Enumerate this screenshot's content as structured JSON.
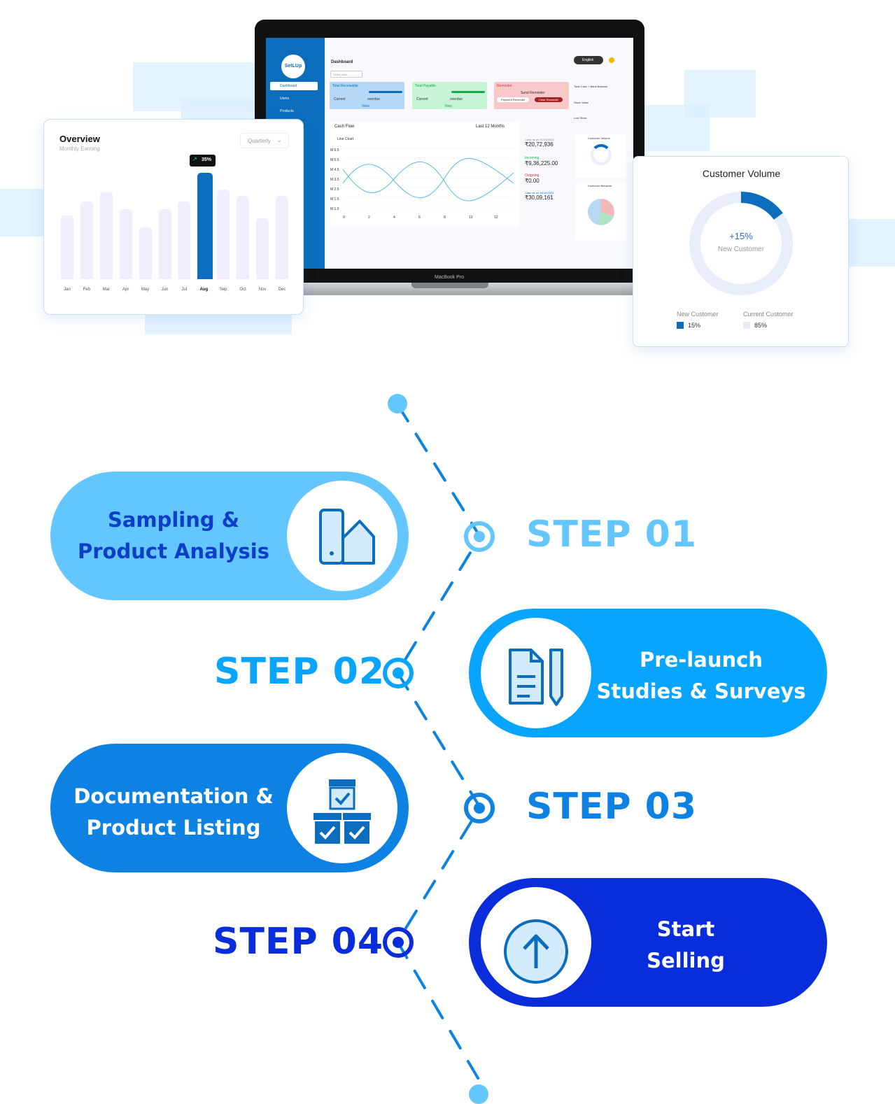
{
  "colors": {
    "step1": "#63c6ff",
    "step2": "#07a5ff",
    "step3": "#0e82e2",
    "step4": "#0a2ddb",
    "step1_text": "#0d3ec7",
    "brand": "#0c6dbd"
  },
  "laptop": {
    "brand": "SetLUp",
    "model_label": "MacBook Pro",
    "sidebar": [
      "Dashboard",
      "Users",
      "Products"
    ],
    "header_title": "Dashboard",
    "language": "English",
    "date_placeholder": "Select date",
    "cards": {
      "receivable": "Total Receivable",
      "payable": "Total Payable",
      "reminder": "Reminder",
      "reminder_action": "Send Reminder",
      "payment_reminder": "Payment Reminder",
      "clear_reminder": "Clear Reminder",
      "current": "Current",
      "overdue": "overdue",
      "view": "View",
      "total_cash": "Total Cash + Bank Balance",
      "stock_value": "Stock Value",
      "low_stock": "Low Stock"
    },
    "cash_flow": {
      "title": "Cash Flow",
      "period": "Last 12 Months",
      "chart_type": "Line Chart",
      "yticks": [
        "M 6.5",
        "M 5.5",
        "M 4.5",
        "M 3.5",
        "M 2.5",
        "M 1.5",
        "M 1.0"
      ],
      "xticks": [
        "0",
        "2",
        "4",
        "6",
        "8",
        "10",
        "12"
      ],
      "cash_as_on": "Cash as on 01/10/2023",
      "cash_value": "₹20,72,936",
      "incoming_label": "Incoming",
      "incoming_value": "₹9,36,225.00",
      "outgoing_label": "Outgoing",
      "outgoing_value": "₹0.00",
      "cash_as_on_2": "Cash as on 16/10/2023",
      "cash_value_2": "₹30,09,161"
    },
    "mini_customer_volume": "Customer Volume",
    "mini_customer_behavior": "Customer Behavior"
  },
  "overview": {
    "title": "Overview",
    "subtitle": "Monthly Earning",
    "period": "Quarterly",
    "badge": "35%",
    "months": [
      "Jan",
      "Feb",
      "Mar",
      "Apr",
      "May",
      "Jun",
      "Jul",
      "Aug",
      "Sep",
      "Oct",
      "Nov",
      "Dec"
    ],
    "values": [
      0.6,
      0.73,
      0.82,
      0.66,
      0.49,
      0.66,
      0.73,
      1.0,
      0.84,
      0.78,
      0.57,
      0.78
    ],
    "active_index": 7
  },
  "customer_volume": {
    "title": "Customer Volume",
    "center_value": "+15%",
    "center_label": "New Customer",
    "legend": [
      {
        "label": "New Customer",
        "value": "15%",
        "color": "#0c6dbd"
      },
      {
        "label": "Current Customer",
        "value": "85%",
        "color": "#e6ecf6"
      }
    ],
    "new_fraction": 0.15
  },
  "steps": [
    {
      "label": "STEP 01",
      "line1": "Sampling &",
      "line2": "Product Analysis",
      "icon": "swatch-icon"
    },
    {
      "label": "STEP 02",
      "line1": "Pre-launch",
      "line2": "Studies & Surveys",
      "icon": "document-pencil-icon"
    },
    {
      "label": "STEP 03",
      "line1": "Documentation &",
      "line2": "Product Listing",
      "icon": "boxes-check-icon"
    },
    {
      "label": "STEP 04",
      "line1": "Start",
      "line2": "Selling",
      "icon": "arrow-up-circle-icon"
    }
  ]
}
